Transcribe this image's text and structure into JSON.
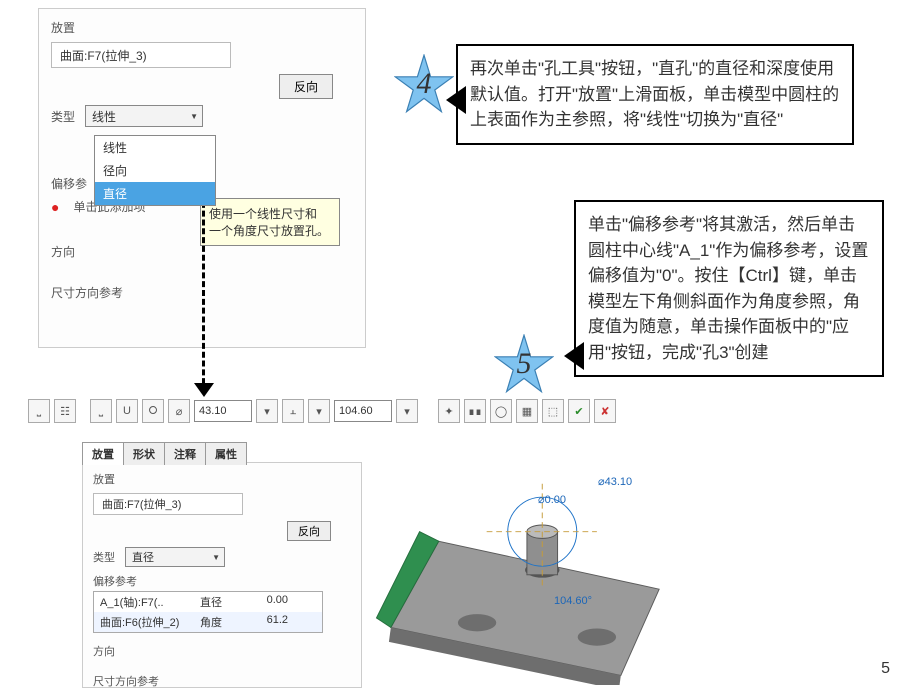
{
  "panel1": {
    "header": "放置",
    "surface_ref": "曲面:F7(拉伸_3)",
    "reverse_btn": "反向",
    "type_label": "类型",
    "type_value": "线性",
    "type_options": [
      "线性",
      "径向",
      "直径"
    ],
    "offset_ref_label": "偏移参",
    "bullet_hint": "单击此添加项",
    "tooltip_l1": "使用一个线性尺寸和",
    "tooltip_l2": "一个角度尺寸放置孔。",
    "direction_label": "方向",
    "dim_dir_label": "尺寸方向参考"
  },
  "panel2": {
    "tabs": [
      "放置",
      "形状",
      "注释",
      "属性"
    ],
    "header": "放置",
    "surface_ref": "曲面:F7(拉伸_3)",
    "reverse_btn": "反向",
    "type_label": "类型",
    "type_value": "直径",
    "offset_label": "偏移参考",
    "table": [
      {
        "ref": "A_1(轴):F7(..",
        "kind": "直径",
        "val": "0.00"
      },
      {
        "ref": "曲面:F6(拉伸_2)",
        "kind": "角度",
        "val": "61.2"
      }
    ],
    "direction_label": "方向",
    "dim_dir_label": "尺寸方向参考"
  },
  "toolbar": {
    "diameter_val": "43.10",
    "depth_val": "104.60"
  },
  "callout4": "再次单击\"孔工具\"按钮，\"直孔\"的直径和深度使用默认值。打开\"放置\"上滑面板，单击模型中圆柱的上表面作为主参照，将\"线性\"切换为\"直径\"",
  "callout5": "单击\"偏移参考\"将其激活，然后单击圆柱中心线\"A_1\"作为偏移参考，设置偏移值为\"0\"。按住【Ctrl】键，单击模型左下角侧斜面作为角度参照，角度值为随意，单击操作面板中的\"应用\"按钮，完成\"孔3\"创建",
  "stars": {
    "s4": "4",
    "s5": "5"
  },
  "view_dims": {
    "d1": "0.00",
    "d2": "43.10",
    "d3": "104.60°"
  },
  "page": "5"
}
